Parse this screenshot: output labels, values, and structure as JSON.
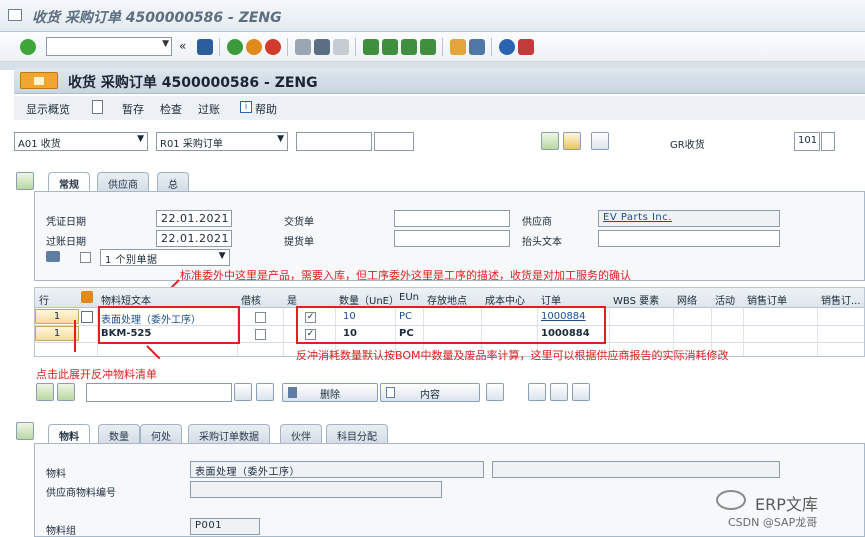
{
  "window": {
    "title": "收货 采购订单 4500000586 - ZENG"
  },
  "std_toolbar": {
    "command_field": ""
  },
  "app": {
    "title": "收货 采购订单 4500000586 - ZENG",
    "toolbar": {
      "overview": "显示概览",
      "hold": "暂存",
      "check": "检查",
      "post": "过账",
      "help": "帮助"
    }
  },
  "selection": {
    "transaction": "A01 收货",
    "reference": "R01 采购订单",
    "doc_number": "",
    "extra": "",
    "gr_label": "GR收货",
    "movement_type": "101"
  },
  "header_tabs": [
    "常规",
    "供应商",
    "总"
  ],
  "header": {
    "doc_date_label": "凭证日期",
    "doc_date": "22.01.2021",
    "post_date_label": "过账日期",
    "post_date": "22.01.2021",
    "delivery_note_label": "交货单",
    "bill_of_lading_label": "提货单",
    "vendor_label": "供应商",
    "vendor": "EV Parts Inc.",
    "header_text_label": "抬头文本",
    "print_option": "1 个别单据"
  },
  "grid": {
    "columns": [
      "行",
      "物料短文本",
      "借核",
      "是",
      "数量（UnE）",
      "EUn",
      "存放地点",
      "成本中心",
      "订单",
      "WBS 要素",
      "网络",
      "活动",
      "销售订单",
      "销售订..."
    ],
    "rows": [
      {
        "line": "1",
        "short_text": "表面处理（委外工序）",
        "ok": true,
        "qty": "10",
        "unit": "PC",
        "order": "1000884"
      },
      {
        "line": "1",
        "short_text": "BKM-525",
        "ok": true,
        "qty": "10",
        "unit": "PC",
        "order": "1000884"
      }
    ]
  },
  "annotations": {
    "top": "标准委外中这里是产品，需要入库，但工序委外这里是工序的描述，收货是对加工服务的确认",
    "bottom_right": "反冲消耗数量默认按BOM中数量及废品率计算，这里可以根据供应商报告的实际消耗修改",
    "bottom_left": "点击此展开反冲物料清单"
  },
  "grid_buttons": {
    "delete": "删除",
    "content": "内容"
  },
  "item_tabs": [
    "物料",
    "数量",
    "何处",
    "采购订单数据",
    "伙伴",
    "科目分配"
  ],
  "item_detail": {
    "material_label": "物料",
    "material_value": "表面处理（委外工序）",
    "vendor_material_label": "供应商物料编号",
    "material_group_label": "物料组",
    "material_group": "P001"
  },
  "watermark": {
    "brand": "ERP文库",
    "credit": "CSDN @SAP龙哥"
  },
  "colors": {
    "accent_orange": "#f0a630",
    "annotation_red": "#e02020",
    "link_blue": "#1a4f8f"
  }
}
